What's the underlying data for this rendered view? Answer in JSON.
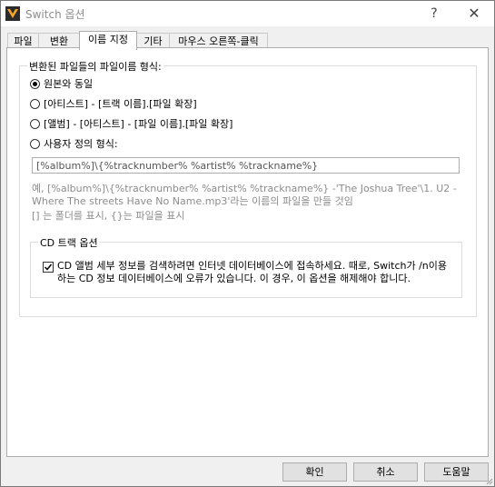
{
  "window": {
    "title": "Switch 옵션",
    "help_label": "?",
    "close_label": "✕"
  },
  "tabs": [
    {
      "label": "파일"
    },
    {
      "label": "변환"
    },
    {
      "label": "이름 지정",
      "active": true
    },
    {
      "label": "기타"
    },
    {
      "label": "마우스 오른쪽-클릭"
    }
  ],
  "naming": {
    "group_label": "변환된 파일들의 파일이름 형식:",
    "options": [
      {
        "label": "원본와 동일",
        "selected": true
      },
      {
        "label": "[아티스트] - [트랙 이름].[파일 확장]",
        "selected": false
      },
      {
        "label": "[앨범] - [아티스트] - [파일 이름].[파일 확장]",
        "selected": false
      },
      {
        "label": "사용자 정의 형식:",
        "selected": false
      }
    ],
    "custom_format_value": "[%album%]\\{%tracknumber% %artist% %trackname%}",
    "example_text": "예,  [%album%]\\{%tracknumber% %artist% %trackname%} -'The Joshua Tree'\\1. U2 - Where The streets Have No Name.mp3'라는 이름의 파일을 만들 것임",
    "hint_text": "[] 는 폴더를 표시, {}는 파일을 표시"
  },
  "cd_track": {
    "group_label": "CD 트랙 옵션",
    "checkbox_checked": true,
    "checkbox_label": "CD 앨범 세부 정보를 검색하려면 인터넷 데이터베이스에 접속하세요. 때로, Switch가 /n이용하는 CD 정보 데이터베이스에 오류가 있습니다. 이 경우, 이 옵션을 해제해야 합니다."
  },
  "buttons": {
    "ok": "확인",
    "cancel": "취소",
    "help": "도움말"
  },
  "colors": {
    "panel_bg": "#ffffff",
    "window_bg": "#f0f0f0",
    "hint_gray": "#8c8c8c"
  }
}
